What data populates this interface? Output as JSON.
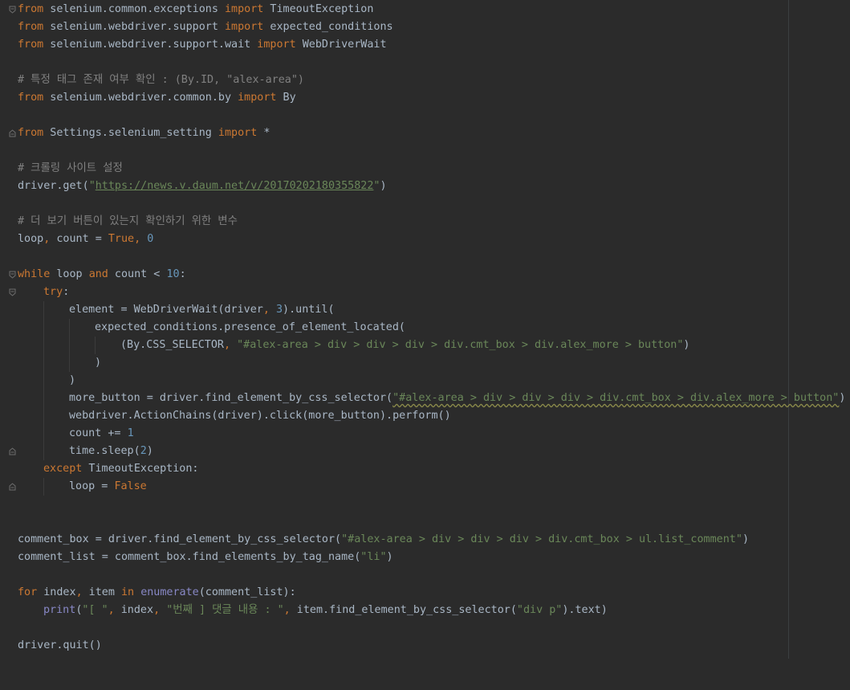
{
  "lines": {
    "l1": {
      "a": "from",
      "b": " selenium.common.exceptions ",
      "c": "import",
      "d": " TimeoutException"
    },
    "l2": {
      "a": "from",
      "b": " selenium.webdriver.support ",
      "c": "import",
      "d": " expected_conditions"
    },
    "l3": {
      "a": "from",
      "b": " selenium.webdriver.support.wait ",
      "c": "import",
      "d": " WebDriverWait"
    },
    "l5": {
      "a": "# 특정 태그 존재 여부 확인 : (By.ID, \"alex-area\")"
    },
    "l6": {
      "a": "from",
      "b": " selenium.webdriver.common.by ",
      "c": "import",
      "d": " By"
    },
    "l8": {
      "a": "from",
      "b": " Settings.selenium_setting ",
      "c": "import",
      "d": " *"
    },
    "l10": {
      "a": "# 크롤링 사이트 설정"
    },
    "l11": {
      "a": "driver.get(",
      "b": "\"",
      "c": "https://news.v.daum.net/v/20170202180355822",
      "d": "\"",
      "e": ")"
    },
    "l13": {
      "a": "# 더 보기 버튼이 있는지 확인하기 위한 변수"
    },
    "l14": {
      "a": "loop",
      "b": ",",
      "c": " count = ",
      "d": "True",
      "e": ",",
      "f": " ",
      "g": "0"
    },
    "l16": {
      "a": "while",
      "b": " loop ",
      "c": "and",
      "d": " count < ",
      "e": "10",
      "f": ":"
    },
    "l17": {
      "a": "try",
      "b": ":"
    },
    "l18": {
      "a": "element = WebDriverWait(driver",
      "b": ",",
      "c": " ",
      "d": "3",
      "e": ").until("
    },
    "l19": {
      "a": "expected_conditions.presence_of_element_located("
    },
    "l20": {
      "a": "(By.CSS_SELECTOR",
      "b": ",",
      "c": " ",
      "d": "\"#alex-area > div > div > div > div.cmt_box > div.alex_more > button\"",
      "e": ")"
    },
    "l21": {
      "a": ")"
    },
    "l22": {
      "a": ")"
    },
    "l23": {
      "a": "more_button = driver.find_element_by_css_selector(",
      "b": "\"#alex-area > div > div > div > div.cmt_box > div.alex_more > button\"",
      "c": ")"
    },
    "l24": {
      "a": "webdriver.ActionChains(driver).click(more_button).perform()"
    },
    "l25": {
      "a": "count += ",
      "b": "1"
    },
    "l26": {
      "a": "time.sleep(",
      "b": "2",
      "c": ")"
    },
    "l27": {
      "a": "except",
      "b": " TimeoutException:"
    },
    "l28": {
      "a": "loop = ",
      "b": "False"
    },
    "l31": {
      "a": "comment_box = driver.find_element_by_css_selector(",
      "b": "\"#alex-area > div > div > div > div.cmt_box > ul.list_comment\"",
      "c": ")"
    },
    "l32": {
      "a": "comment_list = comment_box.find_elements_by_tag_name(",
      "b": "\"li\"",
      "c": ")"
    },
    "l34": {
      "a": "for",
      "b": " index",
      "c": ",",
      "d": " item ",
      "e": "in",
      "f": " ",
      "g": "enumerate",
      "h": "(comment_list):"
    },
    "l35": {
      "a": "print",
      "b": "(",
      "c": "\"[ \"",
      "d": ",",
      "e": " index",
      "f": ",",
      "g": " ",
      "h": "\"번째 ] 댓글 내용 : \"",
      "i": ",",
      "j": " item.find_element_by_css_selector(",
      "k": "\"div p\"",
      "l": ").text)"
    },
    "l37": {
      "a": "driver.quit()"
    }
  },
  "colors": {
    "background": "#2b2b2b",
    "keyword": "#cc7832",
    "string": "#6a8759",
    "comment": "#808080",
    "number": "#6897bb",
    "builtin": "#8888c6",
    "text": "#a9b7c6"
  },
  "icons": {
    "fold_open": "fold-open-icon",
    "fold_close": "fold-close-icon"
  }
}
